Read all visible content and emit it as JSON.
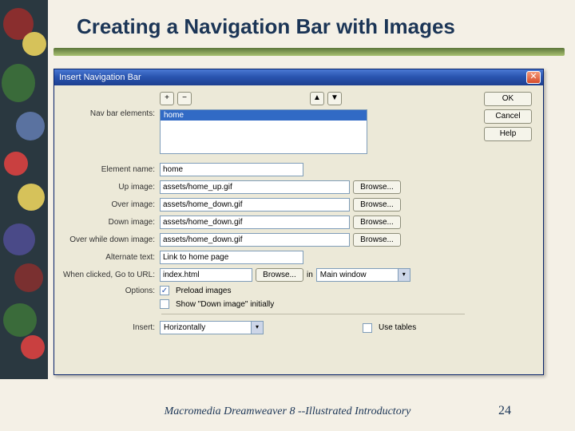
{
  "slide": {
    "title": "Creating a Navigation Bar with Images",
    "footer": "Macromedia Dreamweaver 8 --Illustrated Introductory",
    "number": "24"
  },
  "dialog": {
    "title": "Insert Navigation Bar",
    "buttons": {
      "ok": "OK",
      "cancel": "Cancel",
      "help": "Help"
    },
    "toolbar": {
      "add": "+",
      "remove": "−",
      "up": "▲",
      "down": "▼"
    },
    "labels": {
      "navbar_elements": "Nav bar elements:",
      "element_name": "Element name:",
      "up_image": "Up image:",
      "over_image": "Over image:",
      "down_image": "Down image:",
      "over_while_down": "Over while down image:",
      "alternate_text": "Alternate text:",
      "goto_url": "When clicked, Go to URL:",
      "options": "Options:",
      "insert": "Insert:",
      "in": "in"
    },
    "fields": {
      "navbar_selected": "home",
      "element_name": "home",
      "up_image": "assets/home_up.gif",
      "over_image": "assets/home_down.gif",
      "down_image": "assets/home_down.gif",
      "over_while_down": "assets/home_down.gif",
      "alternate_text": "Link to home page",
      "goto_url": "index.html",
      "target": "Main window",
      "insert_mode": "Horizontally"
    },
    "checkboxes": {
      "preload": {
        "label": "Preload images",
        "checked": true
      },
      "show_down": {
        "label": "Show \"Down image\" initially",
        "checked": false
      },
      "use_tables": {
        "label": "Use tables",
        "checked": false
      }
    },
    "browse": "Browse..."
  }
}
